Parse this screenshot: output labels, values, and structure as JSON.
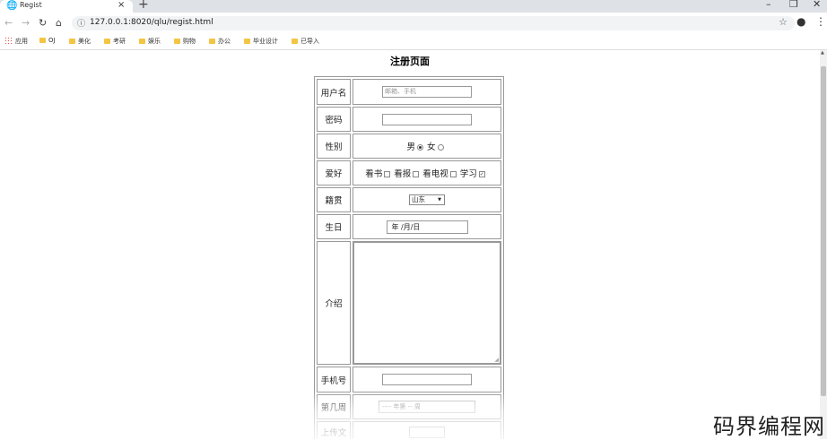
{
  "browser": {
    "tab_title": "Regist",
    "url": "127.0.0.1:8020/qlu/regist.html",
    "bookmarks": [
      "应用",
      "OJ",
      "美化",
      "考研",
      "娱乐",
      "购物",
      "办公",
      "毕业设计",
      "已导入"
    ]
  },
  "page": {
    "title": "注册页面",
    "rows": {
      "username": {
        "label": "用户名",
        "placeholder": "邮箱、手机"
      },
      "password": {
        "label": "密码"
      },
      "gender": {
        "label": "性别",
        "male": "男",
        "female": "女",
        "selected": "男"
      },
      "hobby": {
        "label": "爱好",
        "options": [
          "看书",
          "看报",
          "看电视",
          "学习"
        ],
        "checked": [
          "学习"
        ]
      },
      "hometown": {
        "label": "籍贯",
        "selected": "山东"
      },
      "birthday": {
        "label": "生日",
        "placeholder": "年 /月/日"
      },
      "intro": {
        "label": "介绍"
      },
      "phone": {
        "label": "手机号"
      },
      "week": {
        "label": "第几周",
        "placeholder": "---- 年第 -- 周"
      },
      "upload": {
        "label": "上传文"
      }
    }
  },
  "watermark": "码界编程网",
  "icons": {
    "favicon": "globe-icon",
    "tab_close": "close-icon",
    "new_tab": "plus-icon",
    "back": "back-arrow-icon",
    "forward": "forward-arrow-icon",
    "reload": "reload-icon",
    "home": "home-icon",
    "info": "info-icon",
    "bookmark_star": "star-icon",
    "profile": "account-icon",
    "menu": "kebab-menu-icon"
  }
}
